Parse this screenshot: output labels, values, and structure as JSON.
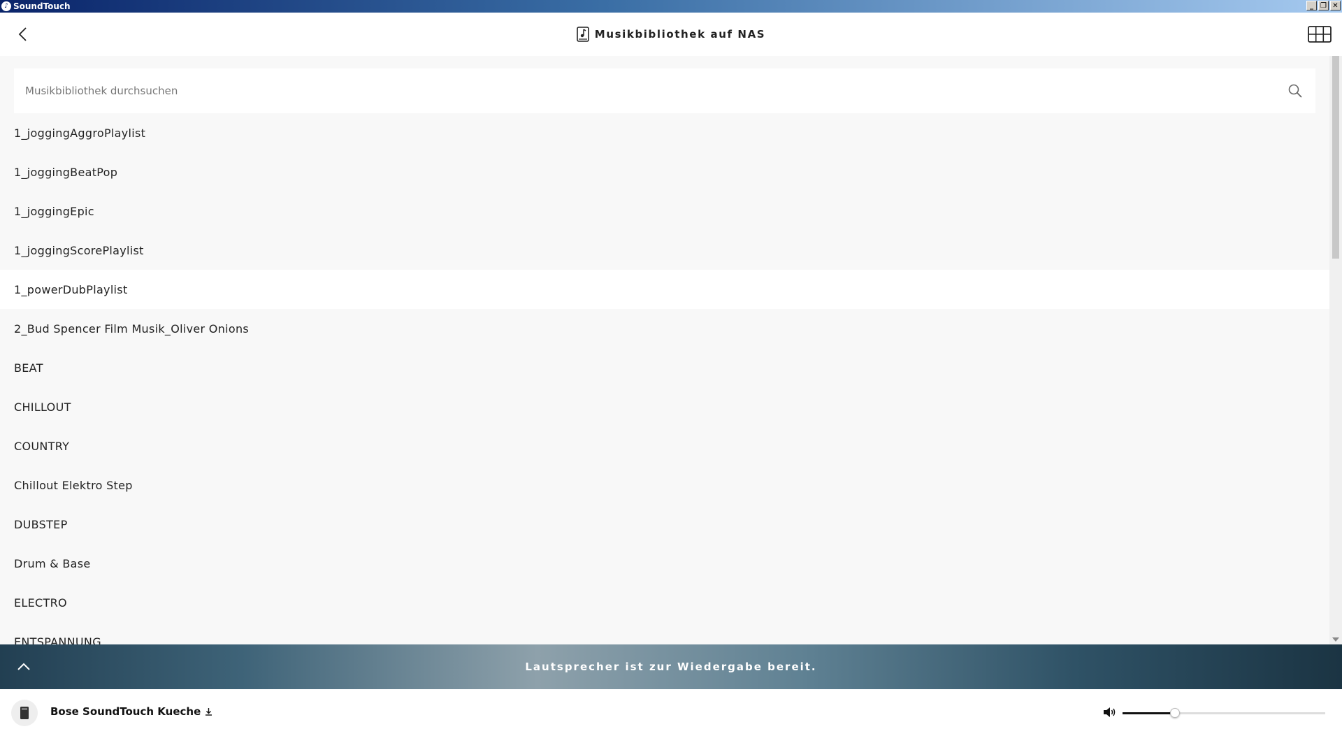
{
  "window": {
    "title": "SoundTouch",
    "controls": {
      "minimize": "_",
      "restore": "❐",
      "close": "✕"
    }
  },
  "header": {
    "title": "Musikbibliothek auf NAS",
    "back_icon": "chevron-left-icon",
    "title_icon": "music-library-icon",
    "grid_icon": "grid-view-icon"
  },
  "search": {
    "placeholder": "Musikbibliothek durchsuchen",
    "value": "",
    "icon": "search-icon"
  },
  "list": {
    "items": [
      {
        "label": "1_joggingAggroPlaylist"
      },
      {
        "label": "1_joggingBeatPop"
      },
      {
        "label": "1_joggingEpic"
      },
      {
        "label": "1_joggingScorePlaylist"
      },
      {
        "label": "1_powerDubPlaylist",
        "highlighted": true
      },
      {
        "label": "2_Bud Spencer Film Musik_Oliver Onions"
      },
      {
        "label": "BEAT"
      },
      {
        "label": "CHILLOUT"
      },
      {
        "label": "COUNTRY"
      },
      {
        "label": "Chillout Elektro Step"
      },
      {
        "label": "DUBSTEP"
      },
      {
        "label": "Drum & Base"
      },
      {
        "label": "ELECTRO"
      },
      {
        "label": "ENTSPANNUNG"
      }
    ]
  },
  "banner": {
    "status": "Lautsprecher ist zur Wiedergabe bereit.",
    "expand_icon": "chevron-up-icon"
  },
  "device": {
    "name": "Bose SoundTouch Kueche",
    "name_icon": "download-arrow-icon",
    "speaker_icon": "speaker-icon",
    "volume_icon": "volume-icon",
    "volume_percent": 26
  },
  "colors": {
    "titlebar_start": "#0a246a",
    "background": "#f8f8f8",
    "banner": "#3e6378",
    "text": "#222222"
  }
}
